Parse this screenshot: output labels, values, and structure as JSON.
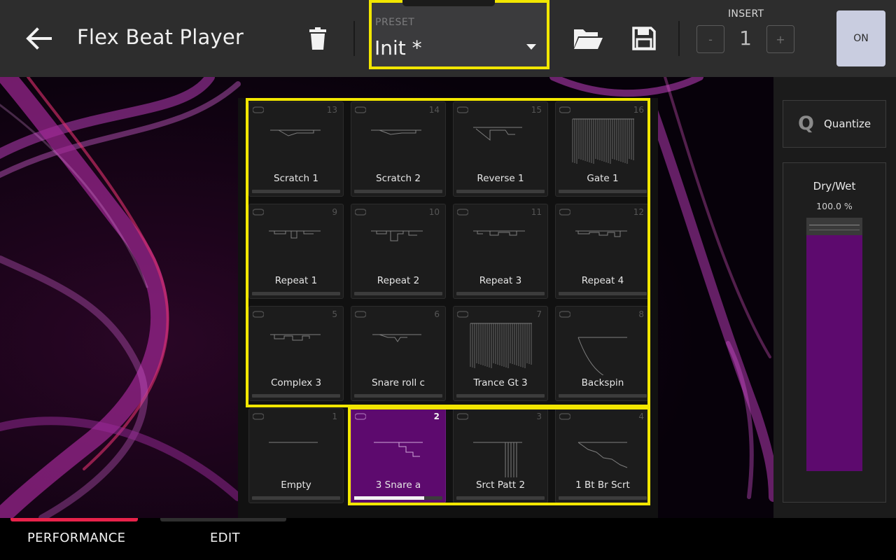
{
  "header": {
    "title": "Flex Beat Player",
    "icons": {
      "back": "back-arrow-icon",
      "trash": "trash-icon",
      "open": "folder-open-icon",
      "save": "save-disk-icon"
    },
    "preset": {
      "label": "PRESET",
      "value": "Init *"
    },
    "insert": {
      "label": "INSERT",
      "value": "1",
      "minus": "-",
      "plus": "+"
    },
    "on_button": "ON"
  },
  "pads": [
    {
      "number": "13",
      "name": "Scratch 1"
    },
    {
      "number": "14",
      "name": "Scratch 2"
    },
    {
      "number": "15",
      "name": "Reverse 1"
    },
    {
      "number": "16",
      "name": "Gate 1"
    },
    {
      "number": "9",
      "name": "Repeat 1"
    },
    {
      "number": "10",
      "name": "Repeat 2"
    },
    {
      "number": "11",
      "name": "Repeat 3"
    },
    {
      "number": "12",
      "name": "Repeat 4"
    },
    {
      "number": "5",
      "name": "Complex 3"
    },
    {
      "number": "6",
      "name": "Snare roll c"
    },
    {
      "number": "7",
      "name": "Trance Gt 3"
    },
    {
      "number": "8",
      "name": "Backspin"
    },
    {
      "number": "1",
      "name": "Empty"
    },
    {
      "number": "2",
      "name": "3 Snare a",
      "selected": true,
      "progress": 0.79
    },
    {
      "number": "3",
      "name": "Srct Patt 2"
    },
    {
      "number": "4",
      "name": "1 Bt Br Scrt"
    }
  ],
  "right_panel": {
    "quantize": {
      "icon_letter": "Q",
      "label": "Quantize"
    },
    "dry_wet": {
      "label": "Dry/Wet",
      "value": "100.0 %",
      "level": 1.0
    }
  },
  "tabs": [
    {
      "label": "PERFORMANCE",
      "active": true
    },
    {
      "label": "EDIT",
      "active": false
    }
  ],
  "colors": {
    "highlight": "#f2e600",
    "accent_purple": "#5d0a6e",
    "active_tab": "#e8224a"
  }
}
